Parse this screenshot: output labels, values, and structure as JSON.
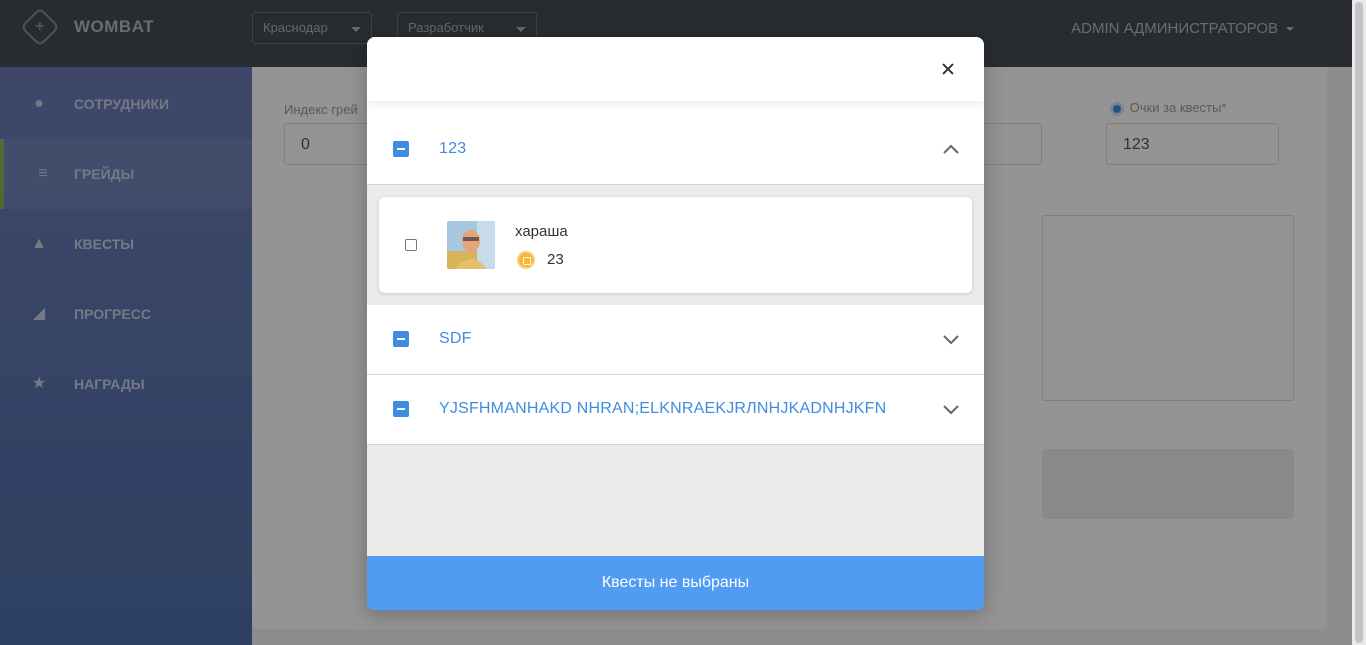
{
  "app": {
    "title": "WOMBAT",
    "city_select": "Краснодар",
    "role_select": "Разработчик",
    "user_menu": "ADMIN АДМИНИСТРАТОРОВ"
  },
  "sidebar": {
    "items": [
      {
        "label": "СОТРУДНИКИ",
        "icon": "user-icon"
      },
      {
        "label": "ГРЕЙДЫ",
        "icon": "layers-icon"
      },
      {
        "label": "КВЕСТЫ",
        "icon": "quest-icon"
      },
      {
        "label": "ПРОГРЕСС",
        "icon": "chart-icon"
      },
      {
        "label": "НАГРАДЫ",
        "icon": "badge-icon"
      }
    ]
  },
  "background_form": {
    "grade_index_label": "Индекс грей",
    "grade_index_value": "0",
    "quest_points_label": "Очки за квесты*",
    "quest_points_value": "123"
  },
  "modal": {
    "groups": [
      {
        "title": "123",
        "expanded": true
      },
      {
        "title": "SDF",
        "expanded": false
      },
      {
        "title": "YJSFHMANHAKD NHRAN;ELKNRAEKJRЛNHJKADNHJKFN",
        "expanded": false
      }
    ],
    "quest": {
      "name": "хараша",
      "points": "23"
    },
    "footer_label": "Квесты не выбраны"
  },
  "colors": {
    "accent": "#3f8de0",
    "footer": "#4f9cf2"
  }
}
